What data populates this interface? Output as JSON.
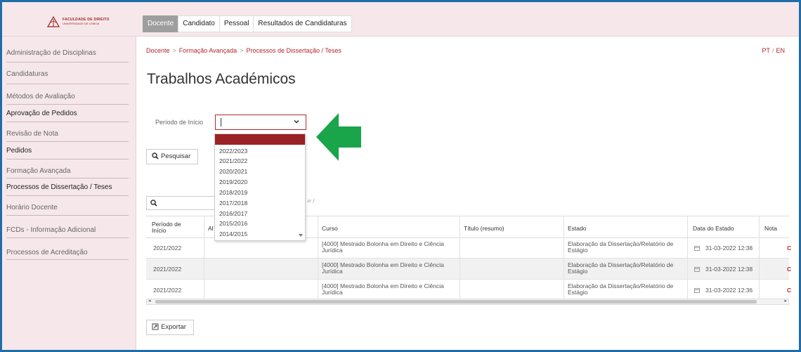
{
  "colors": {
    "brand": "#9d2428",
    "sidebar_bg": "#f6e8ea",
    "link": "#b8242d",
    "selected_option": "#9a2224",
    "arrow": "#1aa54a",
    "frame": "#1f6ca8"
  },
  "logo": {
    "line1": "FACULDADE DE DIREITO",
    "line2": "UNIVERSIDADE DE LISBOA"
  },
  "top_nav": [
    "Docente",
    "Candidato",
    "Pessoal",
    "Resultados de Candidaturas"
  ],
  "sidebar": {
    "items": [
      "Administração de Disciplinas",
      "Candidaturas",
      "Métodos de Avaliação",
      "Aprovação de Pedidos",
      "Revisão de Nota",
      "Pedidos",
      "Formação Avançada",
      "Processos de Dissertação / Teses",
      "Horário Docente",
      "FCDs - Informação Adicional",
      "Processos de Acreditação"
    ]
  },
  "breadcrumb": [
    "Docente",
    "Formação Avançada",
    "Processos de Dissertação / Teses"
  ],
  "breadcrumb_sep": ">",
  "lang": {
    "pt": "PT",
    "sep": "/",
    "en": "EN"
  },
  "page_title": "Trabalhos Académicos",
  "filter": {
    "period_label": "Período de Início",
    "period_value": "",
    "options": [
      "",
      "2022/2023",
      "2021/2022",
      "2020/2021",
      "2019/2020",
      "2018/2019",
      "2017/2018",
      "2016/2017",
      "2015/2016",
      "2014/2015"
    ],
    "search_button": "Pesquisar",
    "hint_fragment": "ar )"
  },
  "table": {
    "headers": [
      "Período de Início",
      "Al",
      "Curso",
      "Título (resumo)",
      "Estado",
      "Data do Estado",
      "Nota"
    ],
    "rows": [
      {
        "period": "2021/2022",
        "curso": "[4000] Mestrado Bolonha em Direito e Ciência Jurídica",
        "titulo": "",
        "estado": "Elaboração da Dissertação/Relatório de Estágio",
        "data": "31-03-2022 12:38",
        "nota": "C"
      },
      {
        "period": "2021/2022",
        "curso": "[4000] Mestrado Bolonha em Direito e Ciência Jurídica",
        "titulo": "",
        "estado": "Elaboração da Dissertação/Relatório de Estágio",
        "data": "31-03-2022 12:38",
        "nota": "C"
      },
      {
        "period": "2021/2022",
        "curso": "[4000] Mestrado Bolonha em Direito e Ciência Jurídica",
        "titulo": "",
        "estado": "Elaboração da Dissertação/Relatório de Estágio",
        "data": "31-03-2022 12:36",
        "nota": "C"
      }
    ]
  },
  "export_button": "Exportar"
}
